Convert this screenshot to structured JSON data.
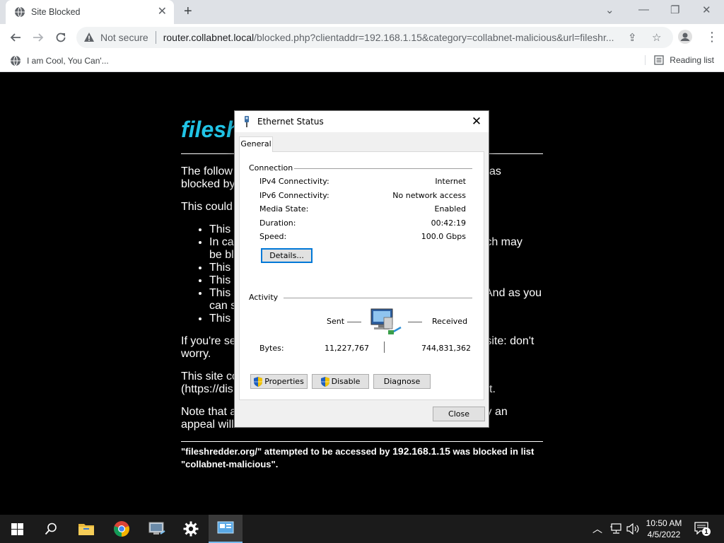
{
  "browser": {
    "tab_title": "Site Blocked",
    "security_label": "Not secure",
    "url_host": "router.collabnet.local",
    "url_rest": "/blocked.php?clientaddr=192.168.1.15&category=collabnet-malicious&url=fileshr...",
    "bookmark_label": "I am Cool, You Can'...",
    "reading_list_label": "Reading list"
  },
  "page": {
    "title": "filesh",
    "intro_a": "The follow",
    "intro_b": "as",
    "intro_c": "blocked by",
    "could_line": "This could",
    "bullets": [
      {
        "left": "This",
        "right": ""
      },
      {
        "left": "In ca",
        "right": "rch may"
      },
      {
        "left": "be bl",
        "right": ""
      },
      {
        "left": "This",
        "right": ""
      },
      {
        "left": "This",
        "right": ""
      },
      {
        "left": "This",
        "right": "And as you"
      },
      {
        "left": "can s",
        "right": ""
      },
      {
        "left": "This",
        "right": ""
      }
    ],
    "if_line_a": "If you're se",
    "if_line_b": "a site: don't",
    "if_line_c": "worry.",
    "site_line_a": "This site co",
    "site_line_b": "(https://dis",
    "site_line_c": "t.",
    "note_a": "Note that a",
    "note_b": "ly an",
    "note_c": "appeal will not unblock it.",
    "footer_a": "\"fileshredder.org/\" attempted to be accessed by ",
    "footer_ip": "192.168.1.15",
    "footer_b": " was blocked in list",
    "footer_c": "\"collabnet-malicious\"."
  },
  "dialog": {
    "title": "Ethernet Status",
    "tab": "General",
    "connection_header": "Connection",
    "rows": [
      {
        "label": "IPv4 Connectivity:",
        "value": "Internet"
      },
      {
        "label": "IPv6 Connectivity:",
        "value": "No network access"
      },
      {
        "label": "Media State:",
        "value": "Enabled"
      },
      {
        "label": "Duration:",
        "value": "00:42:19"
      },
      {
        "label": "Speed:",
        "value": "100.0 Gbps"
      }
    ],
    "details_button": "Details...",
    "activity_header": "Activity",
    "sent_label": "Sent",
    "received_label": "Received",
    "bytes_label": "Bytes:",
    "bytes_sent": "11,227,767",
    "bytes_received": "744,831,362",
    "properties_button": "Properties",
    "disable_button": "Disable",
    "diagnose_button": "Diagnose",
    "close_button": "Close"
  },
  "taskbar": {
    "time": "10:50 AM",
    "date": "4/5/2022",
    "notification_count": "1"
  },
  "colors": {
    "title_cyan": "#21c4e6",
    "taskbar": "#1b1b1b",
    "focus_blue": "#0078d7"
  }
}
